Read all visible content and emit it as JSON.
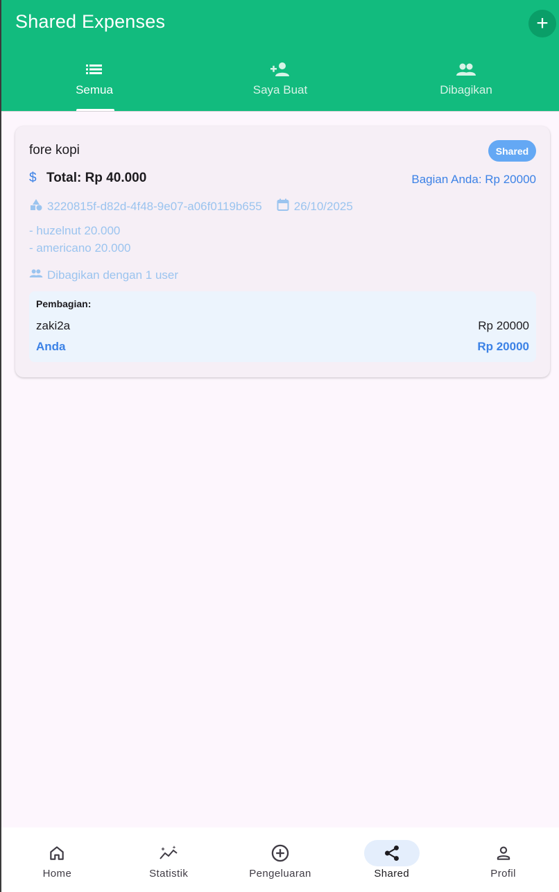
{
  "header": {
    "title": "Shared Expenses",
    "add_icon": "plus-icon"
  },
  "tabs": [
    {
      "label": "Semua",
      "icon": "list-icon",
      "active": true
    },
    {
      "label": "Saya Buat",
      "icon": "person-add-icon",
      "active": false
    },
    {
      "label": "Dibagikan",
      "icon": "group-icon",
      "active": false
    }
  ],
  "expense": {
    "title": "fore kopi",
    "badge": "Shared",
    "total": "Total: Rp 40.000",
    "your_share": "Bagian Anda: Rp 20000",
    "id": "3220815f-d82d-4f48-9e07-a06f0119b655",
    "date": "26/10/2025",
    "items": [
      "- huzelnut 20.000",
      "- americano 20.000"
    ],
    "shared_with": "Dibagikan dengan 1 user",
    "split": {
      "heading": "Pembagian:",
      "rows": [
        {
          "name": "zaki2a",
          "amount": "Rp 20000"
        },
        {
          "name": "Anda",
          "amount": "Rp 20000"
        }
      ]
    }
  },
  "bottom_nav": [
    {
      "label": "Home",
      "icon": "home-icon",
      "active": false
    },
    {
      "label": "Statistik",
      "icon": "chart-icon",
      "active": false
    },
    {
      "label": "Pengeluaran",
      "icon": "add-circle-icon",
      "active": false
    },
    {
      "label": "Shared",
      "icon": "share-icon",
      "active": true
    },
    {
      "label": "Profil",
      "icon": "person-icon",
      "active": false
    }
  ],
  "colors": {
    "appbar": "#12bb7e",
    "accent_blue": "#3c82e6",
    "badge": "#64a8f4",
    "muted_blue": "#9bc4ef",
    "background": "#fdf6fd"
  }
}
